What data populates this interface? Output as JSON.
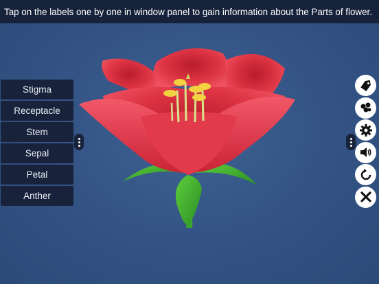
{
  "header": {
    "instruction": "Tap on the labels one by one in window panel to gain information about the Parts of flower."
  },
  "label_panel": {
    "items": [
      {
        "label": "Stigma"
      },
      {
        "label": "Receptacle"
      },
      {
        "label": "Stem"
      },
      {
        "label": "Sepal"
      },
      {
        "label": "Petal"
      },
      {
        "label": "Anther"
      }
    ]
  },
  "toolbar": {
    "icons": [
      "label-tag-icon",
      "flower-parts-icon",
      "gear-icon",
      "speaker-icon",
      "reset-icon",
      "close-icon"
    ]
  },
  "colors": {
    "background": "#345586",
    "panel": "#18223a",
    "petal": "#e23a4a",
    "leaf": "#3cae2e",
    "stamen": "#f2d23f"
  }
}
